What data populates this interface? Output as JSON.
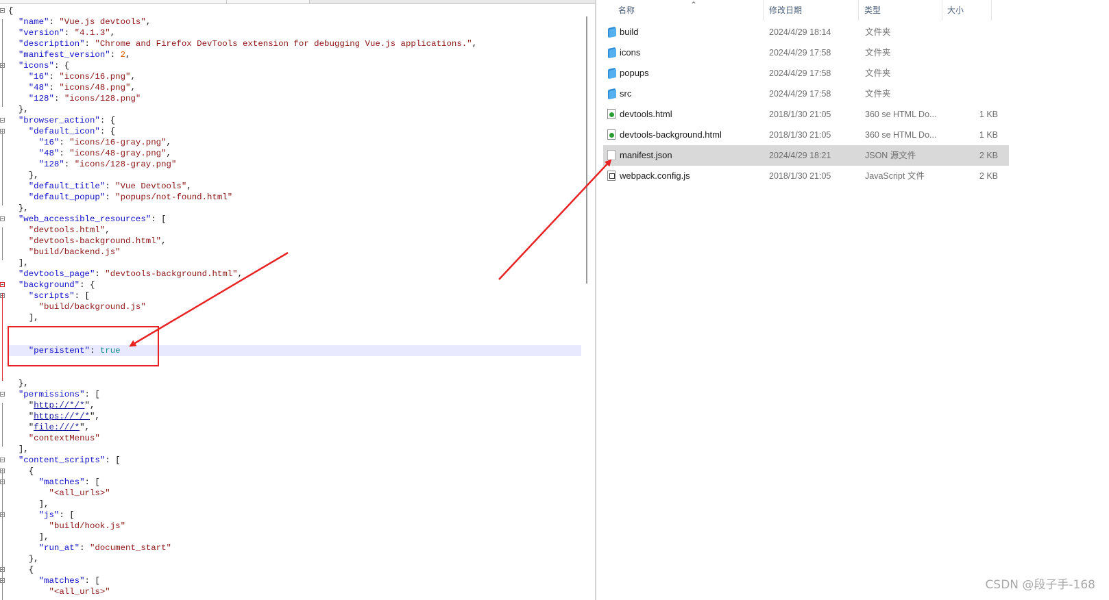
{
  "editor": {
    "lines": [
      [
        [
          "{",
          "p"
        ]
      ],
      [
        [
          "  ",
          "p"
        ],
        [
          "\"name\"",
          "k"
        ],
        [
          ": ",
          "p"
        ],
        [
          "\"Vue.js devtools\"",
          "s"
        ],
        [
          ",",
          "p"
        ]
      ],
      [
        [
          "  ",
          "p"
        ],
        [
          "\"version\"",
          "k"
        ],
        [
          ": ",
          "p"
        ],
        [
          "\"4.1.3\"",
          "s"
        ],
        [
          ",",
          "p"
        ]
      ],
      [
        [
          "  ",
          "p"
        ],
        [
          "\"description\"",
          "k"
        ],
        [
          ": ",
          "p"
        ],
        [
          "\"Chrome and Firefox DevTools extension for debugging Vue.js applications.\"",
          "s"
        ],
        [
          ",",
          "p"
        ]
      ],
      [
        [
          "  ",
          "p"
        ],
        [
          "\"manifest_version\"",
          "k"
        ],
        [
          ": ",
          "p"
        ],
        [
          "2",
          "n"
        ],
        [
          ",",
          "p"
        ]
      ],
      [
        [
          "  ",
          "p"
        ],
        [
          "\"icons\"",
          "k"
        ],
        [
          ": {",
          "p"
        ]
      ],
      [
        [
          "    ",
          "p"
        ],
        [
          "\"16\"",
          "k"
        ],
        [
          ": ",
          "p"
        ],
        [
          "\"icons/16.png\"",
          "s"
        ],
        [
          ",",
          "p"
        ]
      ],
      [
        [
          "    ",
          "p"
        ],
        [
          "\"48\"",
          "k"
        ],
        [
          ": ",
          "p"
        ],
        [
          "\"icons/48.png\"",
          "s"
        ],
        [
          ",",
          "p"
        ]
      ],
      [
        [
          "    ",
          "p"
        ],
        [
          "\"128\"",
          "k"
        ],
        [
          ": ",
          "p"
        ],
        [
          "\"icons/128.png\"",
          "s"
        ]
      ],
      [
        [
          "  },",
          "p"
        ]
      ],
      [
        [
          "  ",
          "p"
        ],
        [
          "\"browser_action\"",
          "k"
        ],
        [
          ": {",
          "p"
        ]
      ],
      [
        [
          "    ",
          "p"
        ],
        [
          "\"default_icon\"",
          "k"
        ],
        [
          ": {",
          "p"
        ]
      ],
      [
        [
          "      ",
          "p"
        ],
        [
          "\"16\"",
          "k"
        ],
        [
          ": ",
          "p"
        ],
        [
          "\"icons/16-gray.png\"",
          "s"
        ],
        [
          ",",
          "p"
        ]
      ],
      [
        [
          "      ",
          "p"
        ],
        [
          "\"48\"",
          "k"
        ],
        [
          ": ",
          "p"
        ],
        [
          "\"icons/48-gray.png\"",
          "s"
        ],
        [
          ",",
          "p"
        ]
      ],
      [
        [
          "      ",
          "p"
        ],
        [
          "\"128\"",
          "k"
        ],
        [
          ": ",
          "p"
        ],
        [
          "\"icons/128-gray.png\"",
          "s"
        ]
      ],
      [
        [
          "    },",
          "p"
        ]
      ],
      [
        [
          "    ",
          "p"
        ],
        [
          "\"default_title\"",
          "k"
        ],
        [
          ": ",
          "p"
        ],
        [
          "\"Vue Devtools\"",
          "s"
        ],
        [
          ",",
          "p"
        ]
      ],
      [
        [
          "    ",
          "p"
        ],
        [
          "\"default_popup\"",
          "k"
        ],
        [
          ": ",
          "p"
        ],
        [
          "\"popups/not-found.html\"",
          "s"
        ]
      ],
      [
        [
          "  },",
          "p"
        ]
      ],
      [
        [
          "  ",
          "p"
        ],
        [
          "\"web_accessible_resources\"",
          "k"
        ],
        [
          ": [",
          "p"
        ]
      ],
      [
        [
          "    ",
          "p"
        ],
        [
          "\"devtools.html\"",
          "s"
        ],
        [
          ",",
          "p"
        ]
      ],
      [
        [
          "    ",
          "p"
        ],
        [
          "\"devtools-background.html\"",
          "s"
        ],
        [
          ",",
          "p"
        ]
      ],
      [
        [
          "    ",
          "p"
        ],
        [
          "\"build/backend.js\"",
          "s"
        ]
      ],
      [
        [
          "  ],",
          "p"
        ]
      ],
      [
        [
          "  ",
          "p"
        ],
        [
          "\"devtools_page\"",
          "k"
        ],
        [
          ": ",
          "p"
        ],
        [
          "\"devtools-background.html\"",
          "s"
        ],
        [
          ",",
          "p"
        ]
      ],
      [
        [
          "  ",
          "p"
        ],
        [
          "\"background\"",
          "k"
        ],
        [
          ": {",
          "p"
        ]
      ],
      [
        [
          "    ",
          "p"
        ],
        [
          "\"scripts\"",
          "k"
        ],
        [
          ": [",
          "p"
        ]
      ],
      [
        [
          "      ",
          "p"
        ],
        [
          "\"build/background.js\"",
          "s"
        ]
      ],
      [
        [
          "    ],",
          "p"
        ]
      ],
      [],
      [],
      [
        [
          "    ",
          "p"
        ],
        [
          "\"persistent\"",
          "k"
        ],
        [
          ": ",
          "p"
        ],
        [
          "true",
          "b"
        ]
      ],
      [],
      [],
      [
        [
          "  },",
          "p"
        ]
      ],
      [
        [
          "  ",
          "p"
        ],
        [
          "\"permissions\"",
          "k"
        ],
        [
          ": [",
          "p"
        ]
      ],
      [
        [
          "    \"",
          "p"
        ],
        [
          "http://*/*",
          "u"
        ],
        [
          "\",",
          "p"
        ]
      ],
      [
        [
          "    \"",
          "p"
        ],
        [
          "https://*/*",
          "u"
        ],
        [
          "\",",
          "p"
        ]
      ],
      [
        [
          "    \"",
          "p"
        ],
        [
          "file:///*",
          "u"
        ],
        [
          "\",",
          "p"
        ]
      ],
      [
        [
          "    ",
          "p"
        ],
        [
          "\"contextMenus\"",
          "s"
        ]
      ],
      [
        [
          "  ],",
          "p"
        ]
      ],
      [
        [
          "  ",
          "p"
        ],
        [
          "\"content_scripts\"",
          "k"
        ],
        [
          ": [",
          "p"
        ]
      ],
      [
        [
          "    {",
          "p"
        ]
      ],
      [
        [
          "      ",
          "p"
        ],
        [
          "\"matches\"",
          "k"
        ],
        [
          ": [",
          "p"
        ]
      ],
      [
        [
          "        ",
          "p"
        ],
        [
          "\"<all_urls>\"",
          "s"
        ]
      ],
      [
        [
          "      ],",
          "p"
        ]
      ],
      [
        [
          "      ",
          "p"
        ],
        [
          "\"js\"",
          "k"
        ],
        [
          ": [",
          "p"
        ]
      ],
      [
        [
          "        ",
          "p"
        ],
        [
          "\"build/hook.js\"",
          "s"
        ]
      ],
      [
        [
          "      ],",
          "p"
        ]
      ],
      [
        [
          "      ",
          "p"
        ],
        [
          "\"run_at\"",
          "k"
        ],
        [
          ": ",
          "p"
        ],
        [
          "\"document_start\"",
          "s"
        ]
      ],
      [
        [
          "    },",
          "p"
        ]
      ],
      [
        [
          "    {",
          "p"
        ]
      ],
      [
        [
          "      ",
          "p"
        ],
        [
          "\"matches\"",
          "k"
        ],
        [
          ": [",
          "p"
        ]
      ],
      [
        [
          "        ",
          "p"
        ],
        [
          "\"<all_urls>\"",
          "s"
        ]
      ]
    ],
    "highlight_line": 31
  },
  "explorer": {
    "columns": {
      "name": "名称",
      "date": "修改日期",
      "type": "类型",
      "size": "大小"
    },
    "files": [
      {
        "name": "build",
        "date": "2024/4/29 18:14",
        "type": "文件夹",
        "size": "",
        "icon": "folder-icon"
      },
      {
        "name": "icons",
        "date": "2024/4/29 17:58",
        "type": "文件夹",
        "size": "",
        "icon": "folder-icon"
      },
      {
        "name": "popups",
        "date": "2024/4/29 17:58",
        "type": "文件夹",
        "size": "",
        "icon": "folder-icon"
      },
      {
        "name": "src",
        "date": "2024/4/29 17:58",
        "type": "文件夹",
        "size": "",
        "icon": "folder-icon"
      },
      {
        "name": "devtools.html",
        "date": "2018/1/30 21:05",
        "type": "360 se HTML Do...",
        "size": "1 KB",
        "icon": "html-file-icon"
      },
      {
        "name": "devtools-background.html",
        "date": "2018/1/30 21:05",
        "type": "360 se HTML Do...",
        "size": "1 KB",
        "icon": "html-file-icon"
      },
      {
        "name": "manifest.json",
        "date": "2024/4/29 18:21",
        "type": "JSON 源文件",
        "size": "2 KB",
        "icon": "json-file-icon",
        "selected": true
      },
      {
        "name": "webpack.config.js",
        "date": "2018/1/30 21:05",
        "type": "JavaScript 文件",
        "size": "2 KB",
        "icon": "js-file-icon"
      }
    ]
  },
  "watermark": "CSDN @段子手-168",
  "colors": {
    "annotation_red": "#e82222",
    "selection": "#d9d9d9",
    "line_highlight": "#e8e8ff"
  }
}
